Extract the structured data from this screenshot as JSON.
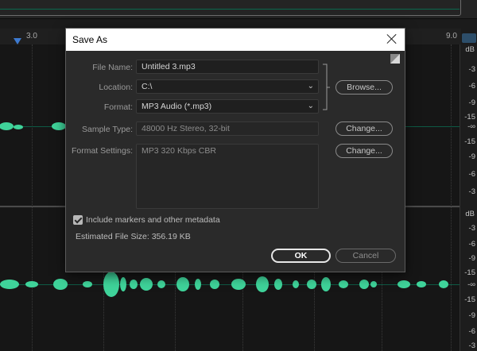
{
  "editor": {
    "ruler_labels": [
      "3.0",
      "9.0"
    ],
    "db_labels": [
      "dB",
      "-3",
      "-6",
      "-9",
      "-15",
      "-∞",
      "-15",
      "-9",
      "-6",
      "-3",
      "dB",
      "-3",
      "-6",
      "-9",
      "-15",
      "-∞",
      "-15",
      "-9",
      "-6",
      "-3"
    ],
    "waveform_color": "#3fd39a"
  },
  "dialog": {
    "title": "Save As",
    "file_name": {
      "label": "File Name:",
      "value": "Untitled 3.mp3"
    },
    "location": {
      "label": "Location:",
      "value": "C:\\"
    },
    "format": {
      "label": "Format:",
      "value": "MP3 Audio (*.mp3)"
    },
    "browse_label": "Browse...",
    "sample_type": {
      "label": "Sample Type:",
      "value": "48000 Hz Stereo, 32-bit",
      "change_label": "Change..."
    },
    "format_settings": {
      "label": "Format Settings:",
      "value": "MP3 320 Kbps CBR",
      "change_label": "Change..."
    },
    "include_markers": {
      "label": "Include markers and other metadata",
      "checked": true
    },
    "estimated_size": "Estimated File Size: 356.19 KB",
    "ok_label": "OK",
    "cancel_label": "Cancel"
  },
  "icons": {
    "close": "close-icon",
    "dropdown": "chevron-down-icon",
    "checkbox": "checkmark-icon",
    "resize": "resize-corner-icon"
  }
}
